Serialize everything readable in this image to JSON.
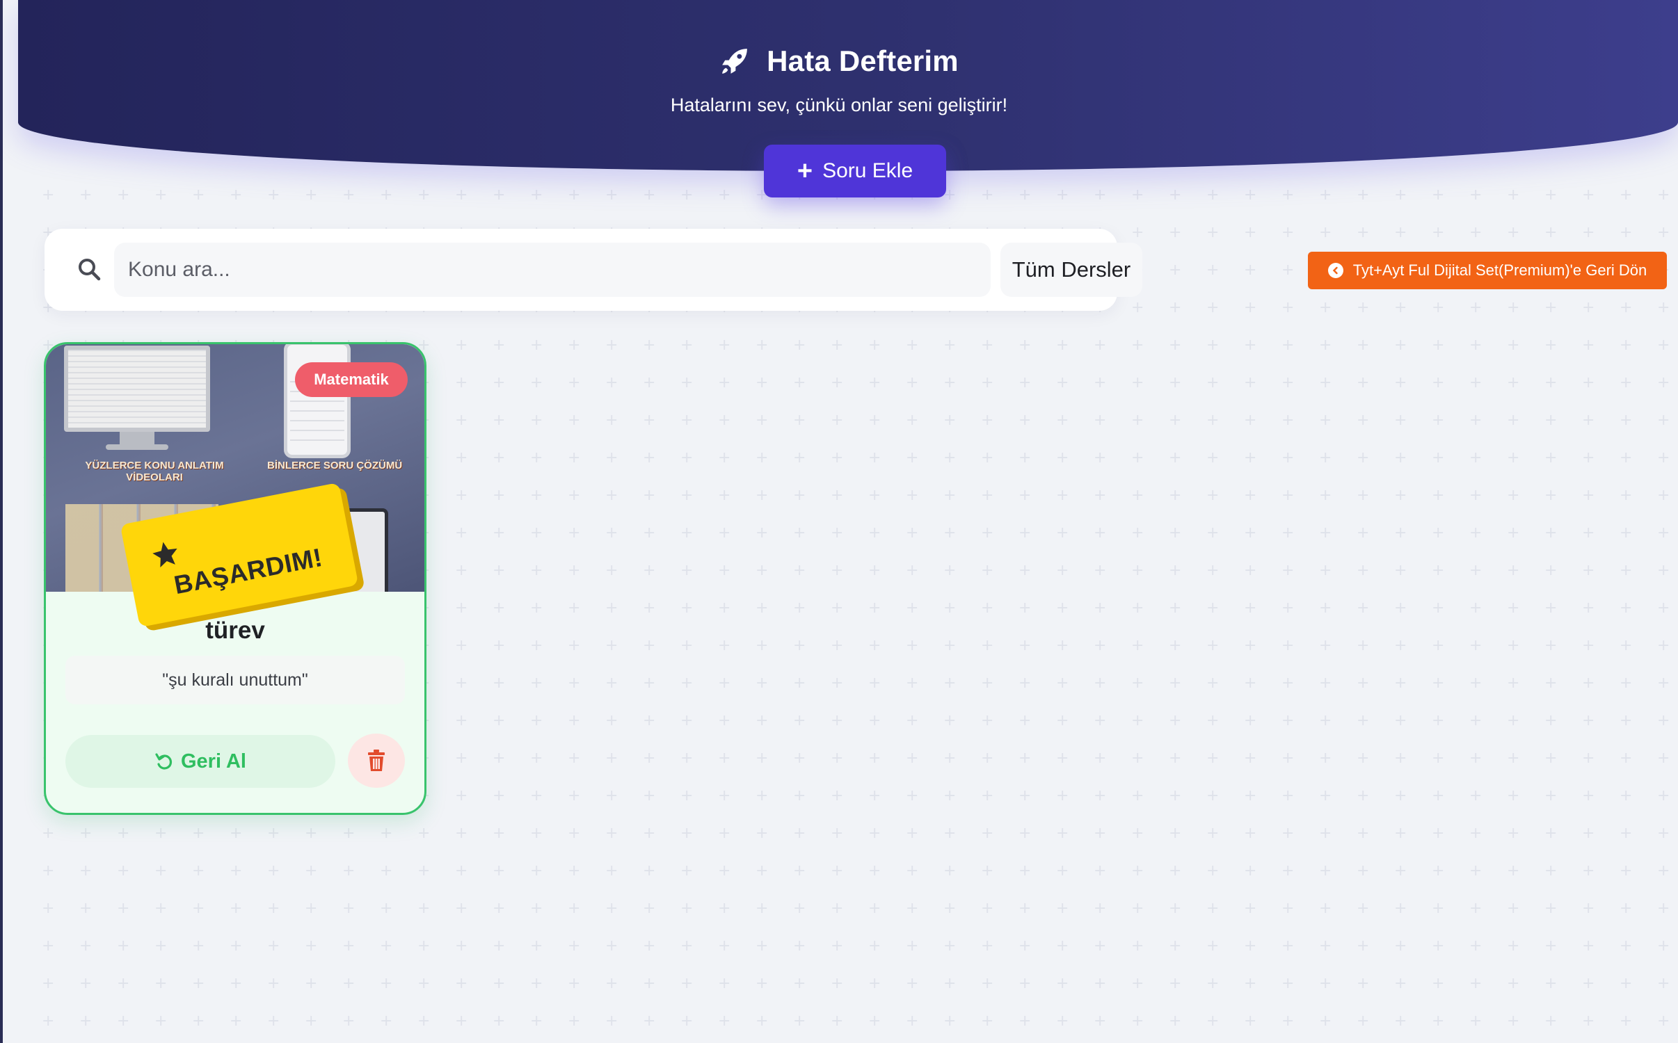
{
  "header": {
    "title": "Hata Defterim",
    "subtitle": "Hatalarını sev, çünkü onlar seni geliştirir!",
    "add_button_label": "Soru Ekle",
    "icon": "rocket-icon"
  },
  "search": {
    "placeholder": "Konu ara...",
    "value": "",
    "subject_filter": "Tüm Dersler"
  },
  "back_button": {
    "label": "Tyt+Ayt Ful Dijital Set(Premium)'e Geri Dön"
  },
  "cards": [
    {
      "subject_tag": "Matematik",
      "stamp_label": "BAŞARDIM!",
      "topic": "türev",
      "note": "\"şu kuralı unuttum\"",
      "undo_label": "Geri Al",
      "image_captions": {
        "left": "YÜZLERCE KONU ANLATIM VİDEOLARI",
        "right": "BİNLERCE SORU ÇÖZÜMÜ"
      }
    }
  ],
  "colors": {
    "header_dark": "#23245a",
    "primary": "#4f35d8",
    "back_button": "#f26315",
    "success": "#39c36c",
    "tag": "#ef5d6a",
    "stamp": "#ffd60a",
    "delete": "#e24b2c"
  }
}
